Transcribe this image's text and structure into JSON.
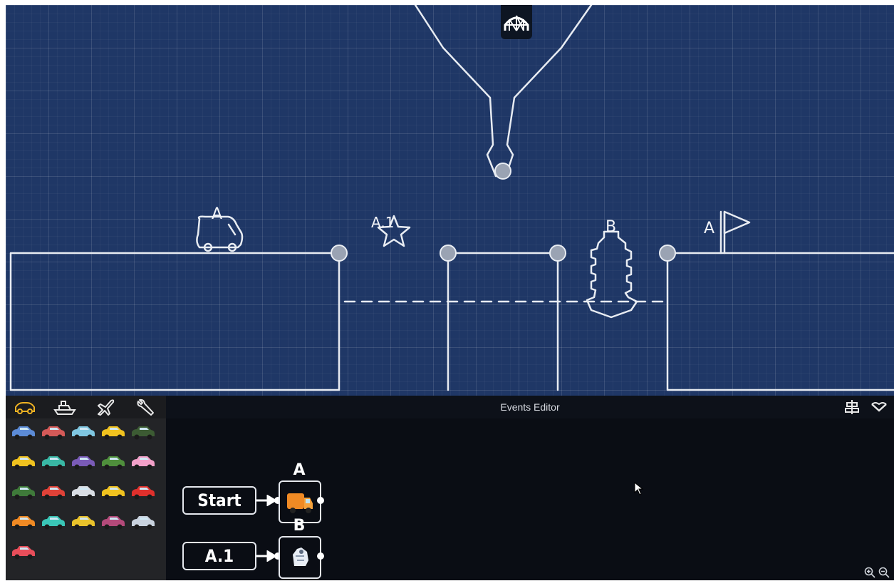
{
  "scene": {
    "labels": {
      "truck": "A",
      "star": "A.1",
      "boat": "B",
      "flag": "A"
    }
  },
  "palette": {
    "categories": [
      {
        "name": "car-icon",
        "active": true
      },
      {
        "name": "boat-icon",
        "active": false
      },
      {
        "name": "plane-icon",
        "active": false
      },
      {
        "name": "wrench-icon",
        "active": false
      }
    ],
    "vehicles": [
      {
        "name": "sedan",
        "color": "#5c8bd6"
      },
      {
        "name": "sports-car",
        "color": "#d45a58"
      },
      {
        "name": "camper-van",
        "color": "#7fc6e0"
      },
      {
        "name": "school-bus",
        "color": "#f0c21f"
      },
      {
        "name": "monster-truck",
        "color": "#3c5b33"
      },
      {
        "name": "dump-truck",
        "color": "#f0c21f"
      },
      {
        "name": "scooter",
        "color": "#39b7a4"
      },
      {
        "name": "hot-rod",
        "color": "#7a5bb7"
      },
      {
        "name": "jeep",
        "color": "#4f8f3c"
      },
      {
        "name": "ice-cream-truck",
        "color": "#f2a0c8"
      },
      {
        "name": "army-truck",
        "color": "#3f7a3a"
      },
      {
        "name": "double-decker-bus",
        "color": "#e04238"
      },
      {
        "name": "police-car",
        "color": "#d9dde3"
      },
      {
        "name": "taxi",
        "color": "#f0c21f"
      },
      {
        "name": "race-car",
        "color": "#e0302c"
      },
      {
        "name": "delivery-van",
        "color": "#f08a24"
      },
      {
        "name": "beetle",
        "color": "#3ac6b7"
      },
      {
        "name": "crane",
        "color": "#e9c22b"
      },
      {
        "name": "motorbike",
        "color": "#b44a7a"
      },
      {
        "name": "stick-figure",
        "color": "#c9d2de"
      },
      {
        "name": "pickup",
        "color": "#e84e5a"
      }
    ]
  },
  "editor": {
    "title": "Events Editor",
    "events": [
      {
        "trigger": "Start",
        "target": "A"
      },
      {
        "trigger": "A.1",
        "target": "B"
      }
    ]
  }
}
